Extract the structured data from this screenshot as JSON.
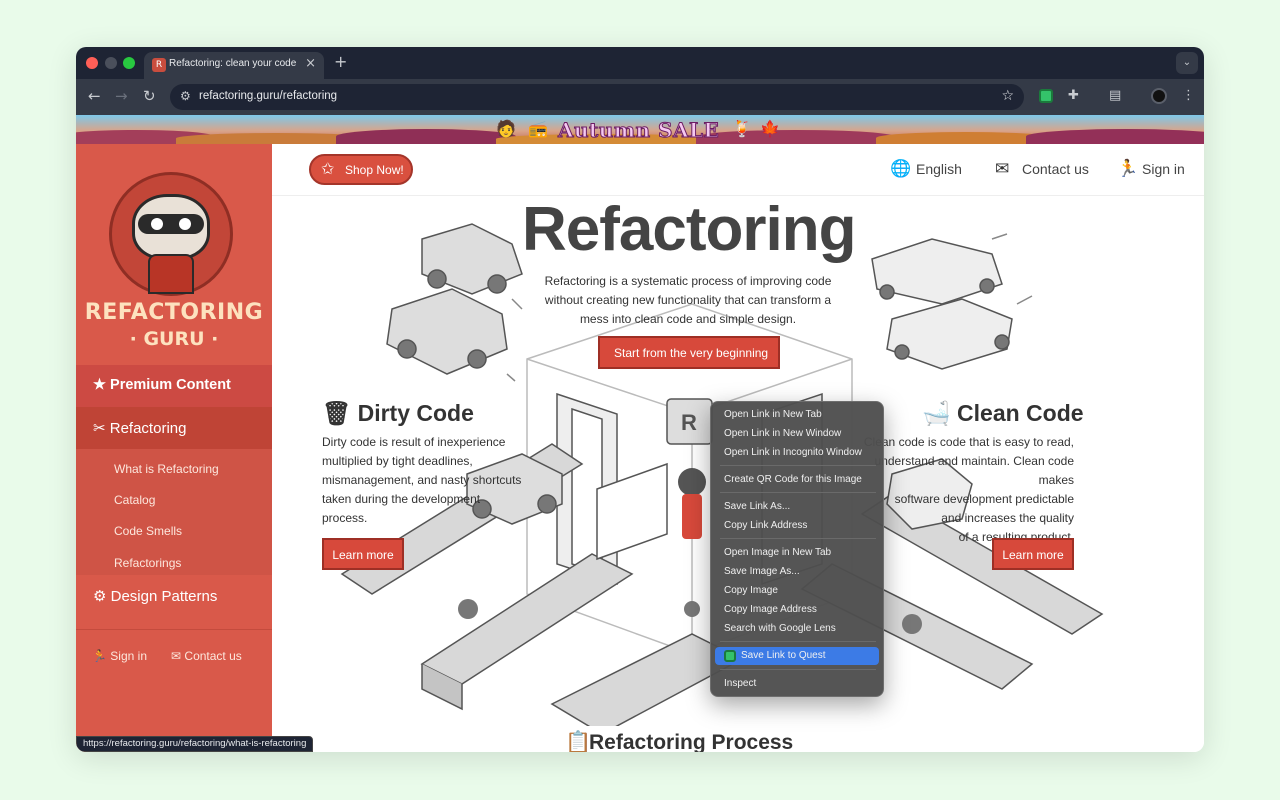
{
  "browser": {
    "tab_title": "Refactoring: clean your code",
    "url": "refactoring.guru/refactoring",
    "status_url": "https://refactoring.guru/refactoring/what-is-refactoring"
  },
  "banner": {
    "text": "Autumn SALE"
  },
  "sidebar": {
    "logo_line1": "REFACTORING",
    "logo_line2": "· GURU ·",
    "premium": "Premium Content",
    "refactoring": "Refactoring",
    "subitems": [
      "What is Refactoring",
      "Catalog",
      "Code Smells",
      "Refactorings"
    ],
    "design_patterns": "Design Patterns",
    "sign_in": "Sign in",
    "contact_us": "Contact us"
  },
  "nav": {
    "shop": "Shop Now!",
    "language": "English",
    "contact": "Contact us",
    "sign_in": "Sign in"
  },
  "hero": {
    "title": "Refactoring",
    "description": "Refactoring is a systematic process of improving code without creating new functionality that can transform a mess into clean code and simple design.",
    "start_button": "Start from the very beginning"
  },
  "dirty": {
    "title": "Dirty Code",
    "description": "Dirty code is result of inexperience multiplied by tight deadlines, mismanagement, and nasty shortcuts taken during the development process.",
    "button": "Learn more"
  },
  "clean": {
    "title": "Clean Code",
    "description_lines": [
      "Clean code is code that is easy to read,",
      "understand and maintain. Clean code makes",
      "software development predictable",
      "and increases the quality",
      "of a resulting product."
    ],
    "button": "Learn more"
  },
  "process": {
    "title": "Refactoring Process"
  },
  "context_menu": {
    "items": [
      "Open Link in New Tab",
      "Open Link in New Window",
      "Open Link in Incognito Window",
      "Create QR Code for this Image",
      "Save Link As...",
      "Copy Link Address",
      "Open Image in New Tab",
      "Save Image As...",
      "Copy Image",
      "Copy Image Address",
      "Search with Google Lens",
      "Save Link to Quest",
      "Inspect"
    ]
  },
  "colors": {
    "brand": "#d9594a",
    "button": "#d7493b",
    "menu_highlight": "#3c7be6"
  }
}
